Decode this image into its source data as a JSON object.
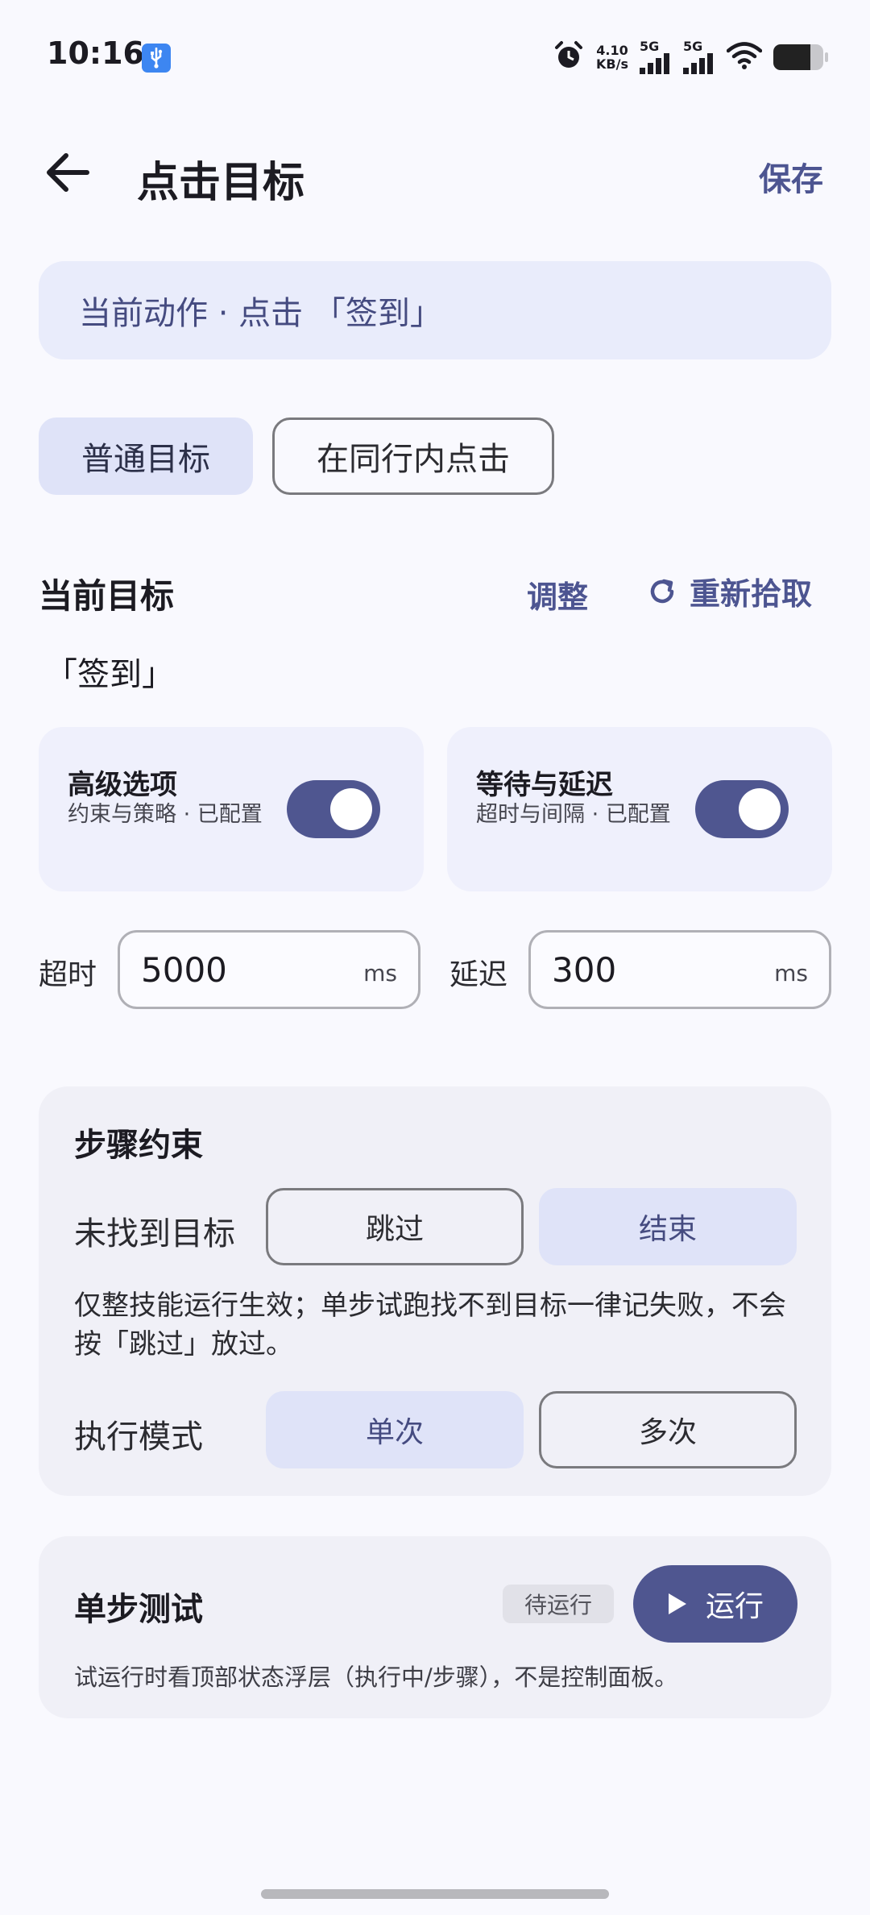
{
  "status_bar": {
    "time": "10:16",
    "net_speed_value": "4.10",
    "net_speed_unit": "KB/s",
    "signal1_label": "5G",
    "signal2_label": "5G"
  },
  "header": {
    "title": "点击目标",
    "save_label": "保存"
  },
  "action_banner": "当前动作 · 点击 「签到」",
  "target_type_chips": [
    {
      "label": "普通目标",
      "selected": true
    },
    {
      "label": "在同行内点击",
      "selected": false
    }
  ],
  "current_target": {
    "title": "当前目标",
    "adjust_label": "调整",
    "repick_label": "重新拾取",
    "value": "「签到」"
  },
  "option_cards": [
    {
      "title": "高级选项",
      "subtitle": "约束与策略 · 已配置",
      "enabled": true
    },
    {
      "title": "等待与延迟",
      "subtitle": "超时与间隔 · 已配置",
      "enabled": true
    }
  ],
  "timing": {
    "timeout_label": "超时",
    "timeout_value": "5000",
    "timeout_unit": "ms",
    "delay_label": "延迟",
    "delay_value": "300",
    "delay_unit": "ms"
  },
  "step_constraints": {
    "title": "步骤约束",
    "not_found_label": "未找到目标",
    "not_found_options": [
      {
        "label": "跳过",
        "selected": false
      },
      {
        "label": "结束",
        "selected": true
      }
    ],
    "note": "仅整技能运行生效；单步试跑找不到目标一律记失败，不会按「跳过」放过。",
    "mode_label": "执行模式",
    "mode_options": [
      {
        "label": "单次",
        "selected": true
      },
      {
        "label": "多次",
        "selected": false
      }
    ]
  },
  "single_step_test": {
    "title": "单步测试",
    "status_badge": "待运行",
    "run_label": "运行",
    "note": "试运行时看顶部状态浮层（执行中/步骤），不是控制面板。"
  },
  "colors": {
    "accent": "#4f5690",
    "selected_chip": "#dfe3f8",
    "card_bg": "#f0f0f7",
    "page_bg": "#f9f9fe"
  }
}
